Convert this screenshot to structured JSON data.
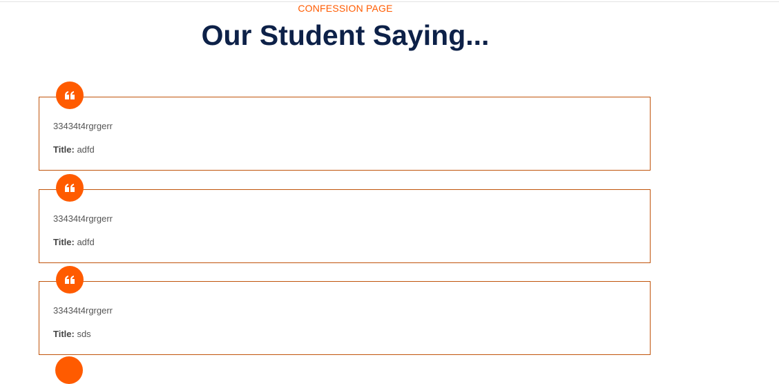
{
  "header": {
    "eyebrow": "CONFESSION PAGE",
    "title": "Our Student Saying..."
  },
  "confessions": [
    {
      "text": "33434t4rgrgerr",
      "title_label": "Title:",
      "title_value": "adfd"
    },
    {
      "text": "33434t4rgrgerr",
      "title_label": "Title:",
      "title_value": "adfd"
    },
    {
      "text": "33434t4rgrgerr",
      "title_label": "Title:",
      "title_value": "sds"
    }
  ],
  "colors": {
    "accent": "#ff5b00",
    "title": "#0d2148",
    "card_border": "#c0530a"
  },
  "icons": {
    "quote": "quote-icon"
  }
}
